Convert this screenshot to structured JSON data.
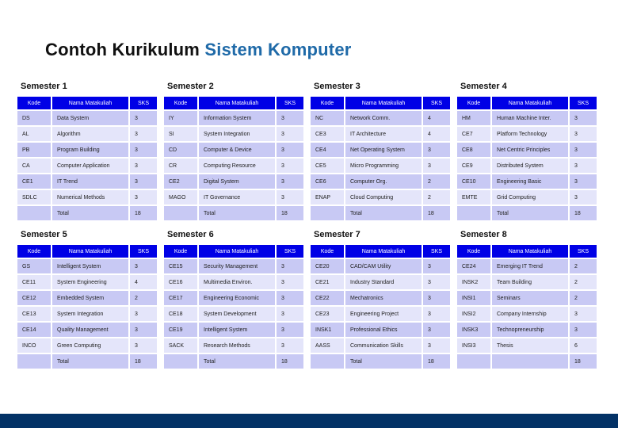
{
  "title": {
    "prefix": "Contoh Kurikulum",
    "accent": "Sistem Komputer"
  },
  "headers": {
    "kode": "Kode",
    "nama": "Nama Matakuliah",
    "sks": "SKS"
  },
  "semesters": [
    {
      "title": "Semester 1",
      "rows": [
        {
          "kode": "DS",
          "nama": "Data System",
          "sks": "3"
        },
        {
          "kode": "AL",
          "nama": "Algorithm",
          "sks": "3"
        },
        {
          "kode": "PB",
          "nama": "Program Building",
          "sks": "3"
        },
        {
          "kode": "CA",
          "nama": "Computer Application",
          "sks": "3"
        },
        {
          "kode": "CE1",
          "nama": "IT Trend",
          "sks": "3"
        },
        {
          "kode": "SDLC",
          "nama": "Numerical Methods",
          "sks": "3"
        }
      ],
      "total": {
        "kode": "",
        "nama": "Total",
        "sks": "18"
      }
    },
    {
      "title": "Semester 2",
      "rows": [
        {
          "kode": "IY",
          "nama": "Information System",
          "sks": "3"
        },
        {
          "kode": "SI",
          "nama": "System Integration",
          "sks": "3"
        },
        {
          "kode": "CD",
          "nama": "Computer & Device",
          "sks": "3"
        },
        {
          "kode": "CR",
          "nama": "Computing Resource",
          "sks": "3"
        },
        {
          "kode": "CE2",
          "nama": "Digital System",
          "sks": "3"
        },
        {
          "kode": "MAGO",
          "nama": "IT Governance",
          "sks": "3"
        }
      ],
      "total": {
        "kode": "",
        "nama": "Total",
        "sks": "18"
      }
    },
    {
      "title": "Semester 3",
      "rows": [
        {
          "kode": "NC",
          "nama": "Network Comm.",
          "sks": "4"
        },
        {
          "kode": "CE3",
          "nama": "IT Architecture",
          "sks": "4"
        },
        {
          "kode": "CE4",
          "nama": "Net Operating System",
          "sks": "3"
        },
        {
          "kode": "CE5",
          "nama": "Micro Programming",
          "sks": "3"
        },
        {
          "kode": "CE6",
          "nama": "Computer Org.",
          "sks": "2"
        },
        {
          "kode": "ENAP",
          "nama": "Cloud Computing",
          "sks": "2"
        }
      ],
      "total": {
        "kode": "",
        "nama": "Total",
        "sks": "18"
      }
    },
    {
      "title": "Semester 4",
      "rows": [
        {
          "kode": "HM",
          "nama": "Human Machine Inter.",
          "sks": "3"
        },
        {
          "kode": "CE7",
          "nama": "Platform Technology",
          "sks": "3"
        },
        {
          "kode": "CE8",
          "nama": "Net Centric Principles",
          "sks": "3"
        },
        {
          "kode": "CE9",
          "nama": "Distributed System",
          "sks": "3"
        },
        {
          "kode": "CE10",
          "nama": "Engineering Basic",
          "sks": "3"
        },
        {
          "kode": "EMTE",
          "nama": "Grid Computing",
          "sks": "3"
        }
      ],
      "total": {
        "kode": "",
        "nama": "Total",
        "sks": "18"
      }
    },
    {
      "title": "Semester 5",
      "rows": [
        {
          "kode": "GS",
          "nama": "Intelligent System",
          "sks": "3"
        },
        {
          "kode": "CE11",
          "nama": "System Engineering",
          "sks": "4"
        },
        {
          "kode": "CE12",
          "nama": "Embedded System",
          "sks": "2"
        },
        {
          "kode": "CE13",
          "nama": "System Integration",
          "sks": "3"
        },
        {
          "kode": "CE14",
          "nama": "Quality Management",
          "sks": "3"
        },
        {
          "kode": "INCO",
          "nama": "Green Computing",
          "sks": "3"
        }
      ],
      "total": {
        "kode": "",
        "nama": "Total",
        "sks": "18"
      }
    },
    {
      "title": "Semester 6",
      "rows": [
        {
          "kode": "CE15",
          "nama": "Security Management",
          "sks": "3"
        },
        {
          "kode": "CE16",
          "nama": "Multimedia Environ.",
          "sks": "3"
        },
        {
          "kode": "CE17",
          "nama": "Engineering Economic",
          "sks": "3"
        },
        {
          "kode": "CE18",
          "nama": "System Development",
          "sks": "3"
        },
        {
          "kode": "CE19",
          "nama": "Intelligent System",
          "sks": "3"
        },
        {
          "kode": "SACK",
          "nama": "Research Methods",
          "sks": "3"
        }
      ],
      "total": {
        "kode": "",
        "nama": "Total",
        "sks": "18"
      }
    },
    {
      "title": "Semester 7",
      "rows": [
        {
          "kode": "CE20",
          "nama": "CAD/CAM Utility",
          "sks": "3"
        },
        {
          "kode": "CE21",
          "nama": "Industry Standard",
          "sks": "3"
        },
        {
          "kode": "CE22",
          "nama": "Mechatronics",
          "sks": "3"
        },
        {
          "kode": "CE23",
          "nama": "Engineering Project",
          "sks": "3"
        },
        {
          "kode": "INSK1",
          "nama": "Professional Ethics",
          "sks": "3"
        },
        {
          "kode": "AASS",
          "nama": "Communication Skills",
          "sks": "3"
        }
      ],
      "total": {
        "kode": "",
        "nama": "Total",
        "sks": "18"
      }
    },
    {
      "title": "Semester 8",
      "rows": [
        {
          "kode": "CE24",
          "nama": "Emerging IT Trend",
          "sks": "2"
        },
        {
          "kode": "INSK2",
          "nama": "Team Building",
          "sks": "2"
        },
        {
          "kode": "INSI1",
          "nama": "Seminars",
          "sks": "2"
        },
        {
          "kode": "INSI2",
          "nama": "Company Internship",
          "sks": "3"
        },
        {
          "kode": "INSK3",
          "nama": "Technopreneurship",
          "sks": "3"
        },
        {
          "kode": "INSI3",
          "nama": "Thesis",
          "sks": "6"
        }
      ],
      "total": {
        "kode": "",
        "nama": "",
        "sks": "18"
      }
    }
  ],
  "colors": {
    "title_accent": "#1f6aa8",
    "header_bg": "#0000e6",
    "row_odd": "#c8c9f4",
    "row_even": "#e4e5fa",
    "footer_bar": "#033266"
  }
}
